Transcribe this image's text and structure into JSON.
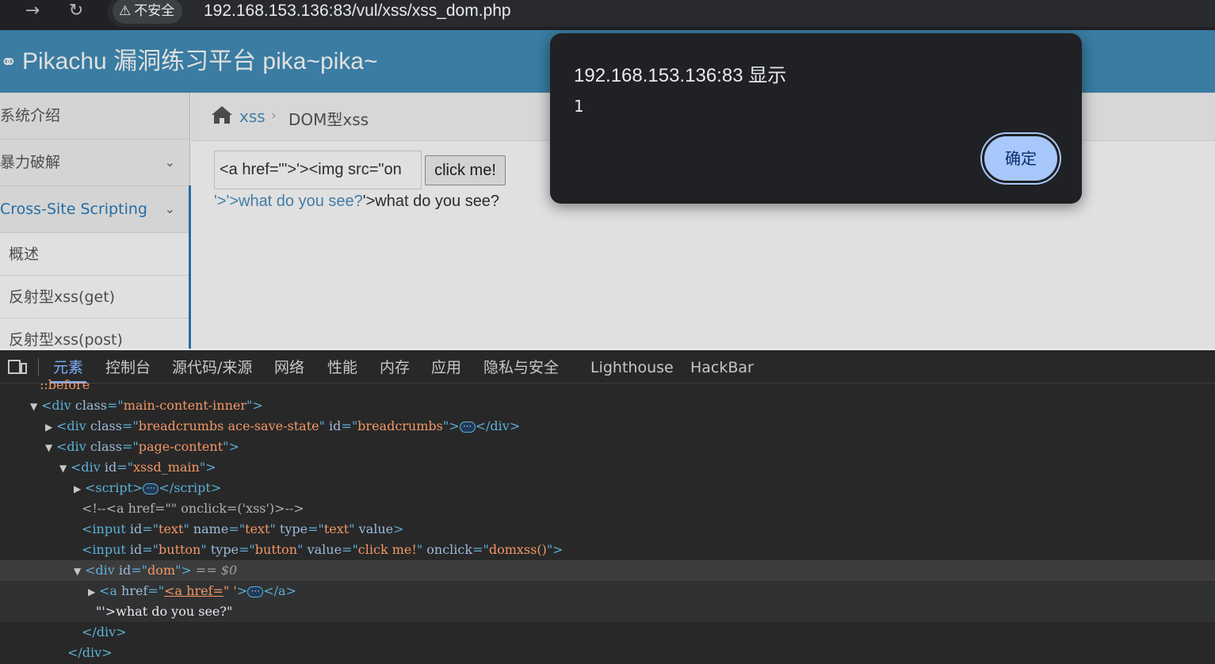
{
  "browser": {
    "back_icon": "arrow-right-icon",
    "reload_icon": "reload-icon",
    "security_label": "不安全",
    "url": "192.168.153.136:83/vul/xss/xss_dom.php"
  },
  "page": {
    "brand": "Pikachu 漏洞练习平台 pika~pika~",
    "sidebar": {
      "items": [
        {
          "label": "系统介绍"
        },
        {
          "label": "暴力破解"
        },
        {
          "label": "Cross-Site Scripting"
        }
      ],
      "subitems": [
        "概述",
        "反射型xss(get)",
        "反射型xss(post)"
      ]
    },
    "breadcrumbs": {
      "xss": "xss",
      "current": "DOM型xss"
    },
    "input_value": "<a href=\"'>'><img src=\"on",
    "button_label": "click me!",
    "output_link": "'>'>what do you see?",
    "output_text": "'>what do you see?"
  },
  "dialog": {
    "title": "192.168.153.136:83 显示",
    "message": "1",
    "ok_label": "确定"
  },
  "devtools": {
    "tabs": [
      "元素",
      "控制台",
      "源代码/来源",
      "网络",
      "性能",
      "内存",
      "应用",
      "隐私与安全",
      "Lighthouse",
      "HackBar"
    ],
    "lines": {
      "before": "::before",
      "main_class": "main-content-inner",
      "bc_class": "breadcrumbs ace-save-state",
      "bc_id": "breadcrumbs",
      "pc_class": "page-content",
      "xssd_id": "xssd_main",
      "comment": "<!--<a href=\"\" onclick=('xss')>-->",
      "input1_id": "text",
      "input1_name": "text",
      "input1_type": "text",
      "input2_id": "button",
      "input2_type": "button",
      "input2_value": "click me!",
      "input2_onclick": "domxss()",
      "dom_id": "dom",
      "dom_marker": "== $0",
      "a_href": "<a href=",
      "a_href_rest": "'",
      "text_node": "\"'>what do you see?\""
    }
  }
}
